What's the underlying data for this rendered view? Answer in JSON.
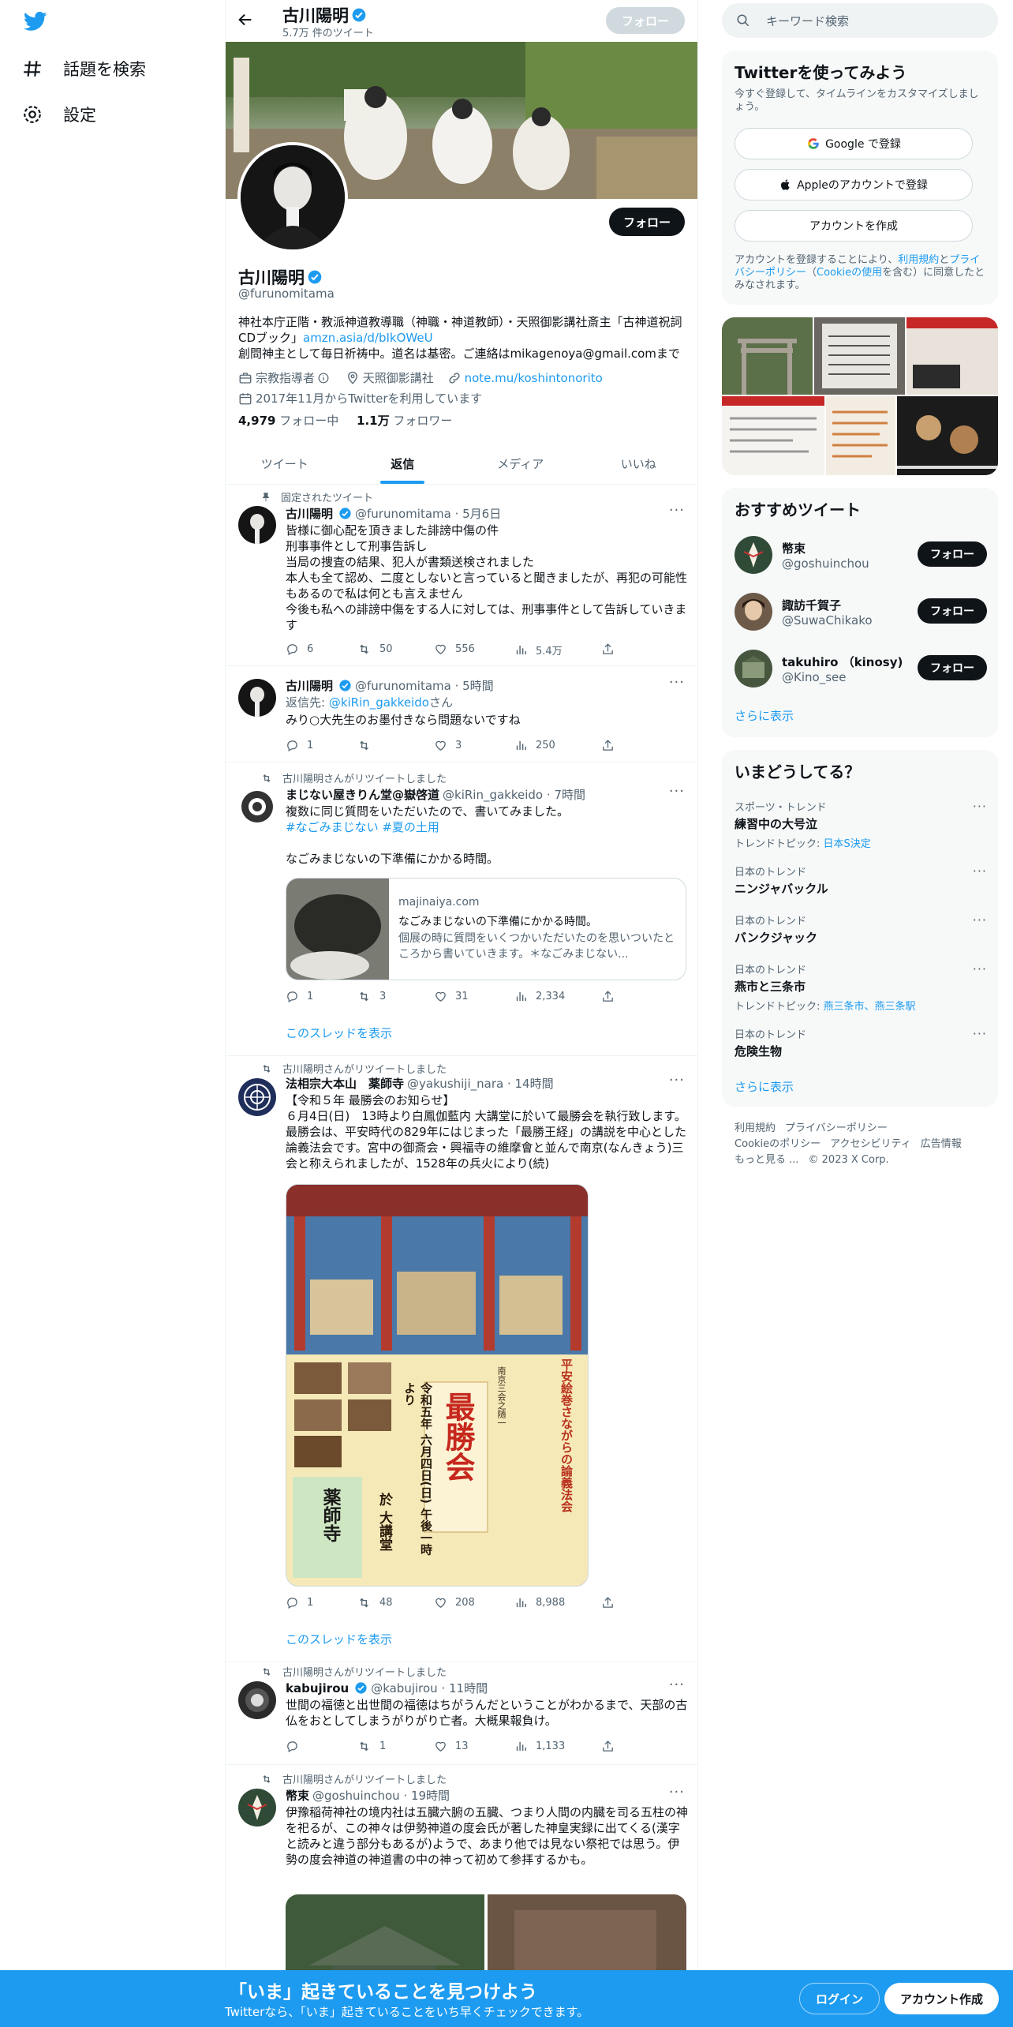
{
  "nav": {
    "explore": "話題を検索",
    "settings": "設定"
  },
  "header": {
    "name": "古川陽明",
    "tweet_count": "5.7万 件のツイート",
    "follow": "フォロー"
  },
  "profile": {
    "name": "古川陽明",
    "handle": "@furunomitama",
    "follow": "フォロー",
    "bio_line1": "神社本庁正階・教派神道教導職（神職・神道教師）・天照御影講社斎主「古神道祝詞CDブック」",
    "bio_link": "amzn.asia/d/bIkOWeU",
    "bio_line2": "創問神主として毎日祈祷中。道名は基密。ご連絡はmikagenoya@gmail.comまで",
    "category": "宗教指導者",
    "location": "天照御影講社",
    "website": "note.mu/koshintonorito",
    "joined": "2017年11月からTwitterを利用しています",
    "following_num": "4,979",
    "following_label": "フォロー中",
    "followers_num": "1.1万",
    "followers_label": "フォロワー"
  },
  "tabs": [
    "ツイート",
    "返信",
    "メディア",
    "いいね"
  ],
  "tweets": [
    {
      "context": "固定されたツイート",
      "name": "古川陽明",
      "handle": "@furunomitama",
      "time": "5月6日",
      "text": "皆様に御心配を頂きました誹謗中傷の件\n刑事事件として刑事告訴し\n当局の捜査の結果、犯人が書類送検されました\n本人も全て認め、二度としないと言っていると聞きましたが、再犯の可能性もあるので私は何とも言えません\n今後も私への誹謗中傷をする人に対しては、刑事事件として告訴していきます",
      "replies": "6",
      "retweets": "50",
      "likes": "556",
      "views": "5.4万"
    },
    {
      "name": "古川陽明",
      "handle": "@furunomitama",
      "time": "5時間",
      "reply_to_label": "返信先: ",
      "reply_to": "@kiRin_gakkeido",
      "reply_to_suffix": "さん",
      "text": "みり○大先生のお墨付きなら問題ないですね",
      "replies": "1",
      "retweets": "",
      "likes": "3",
      "views": "250"
    },
    {
      "context": "古川陽明さんがリツイートしました",
      "name": "まじない屋きりん堂@嶽啓道",
      "handle": "@kiRin_gakkeido",
      "time": "7時間",
      "text1": "複数に同じ質問をいただいたので、書いてみました。",
      "hashtags": "#なごみまじない #夏の土用",
      "text2": "なごみまじないの下準備にかかる時間。",
      "card_domain": "majinaiya.com",
      "card_title": "なごみまじないの下準備にかかる時間。",
      "card_desc": "個展の時に質問をいくつかいただいたのを思いついたところから書いていきます。＊なごみまじない...",
      "replies": "1",
      "retweets": "3",
      "likes": "31",
      "views": "2,334",
      "show_thread": "このスレッドを表示"
    },
    {
      "context": "古川陽明さんがリツイートしました",
      "name": "法相宗大本山　薬師寺",
      "handle": "@yakushiji_nara",
      "time": "14時間",
      "text": "【令和５年 最勝会のお知らせ】\n６月4日(日)　13時より白鳳伽藍内 大講堂に於いて最勝会を執行致します。最勝会は、平安時代の829年にはじまった「最勝王経」の講説を中心とした論義法会です。宮中の御斎会・興福寺の維摩會と並んで南京(なんきょう)三会と称えられましたが、1528年の兵火により(続)",
      "poster_main": "最勝会",
      "poster_side": "平安絵巻さながらの論義法会",
      "poster_date": "令和五年 六月四日(日) 午後一時より",
      "poster_place": "於 大講堂",
      "poster_temple": "薬師寺",
      "poster_kicker": "南京三会之随一",
      "replies": "1",
      "retweets": "48",
      "likes": "208",
      "views": "8,988",
      "show_thread": "このスレッドを表示"
    },
    {
      "context": "古川陽明さんがリツイートしました",
      "name": "kabujirou",
      "handle": "@kabujirou",
      "time": "11時間",
      "text": "世間の福徳と出世間の福徳はちがうんだということがわかるまで、天部の古仏をおとしてしまうがりがり亡者。大概果報負け。",
      "replies": "",
      "retweets": "1",
      "likes": "13",
      "views": "1,133"
    },
    {
      "context": "古川陽明さんがリツイートしました",
      "name": "幣束",
      "handle": "@goshuinchou",
      "time": "19時間",
      "text": "伊豫稲荷神社の境内社は五臓六腑の五臓、つまり人間の内臓を司る五柱の神を祀るが、この神々は伊勢神道の度会氏が著した神皇実録に出てくる(漢字と読みと違う部分もあるが)ようで、あまり他では見ない祭祀では思う。伊勢の度会神道の神道書の中の神って初めて参拝するかも。"
    }
  ],
  "sidebar": {
    "search_placeholder": "キーワード検索",
    "signup_title": "Twitterを使ってみよう",
    "signup_sub": "今すぐ登録して、タイムラインをカスタマイズしましょう。",
    "google": "Google で登録",
    "apple": "Appleのアカウントで登録",
    "create": "アカウントを作成",
    "terms_1": "アカウントを登録することにより、",
    "terms_link1": "利用規約",
    "terms_2": "と",
    "terms_link2": "プライバシーポリシー",
    "terms_3": "（",
    "terms_link3": "Cookieの使用",
    "terms_4": "を含む）に同意したとみなされます。",
    "recommend_title": "おすすめツイート",
    "recommend": [
      {
        "name": "幣束",
        "handle": "@goshuinchou",
        "btn": "フォロー"
      },
      {
        "name": "諏訪千賀子",
        "handle": "@SuwaChikako",
        "btn": "フォロー"
      },
      {
        "name": "takuhiro （kinosy)",
        "handle": "@Kino_see",
        "btn": "フォロー"
      }
    ],
    "show_more": "さらに表示",
    "trends_title": "いまどうしてる？",
    "trends": [
      {
        "cat": "スポーツ・トレンド",
        "name": "練習中の大号泣",
        "sub_label": "トレンドトピック: ",
        "sub_link": "日本S決定"
      },
      {
        "cat": "日本のトレンド",
        "name": "ニンジャバックル"
      },
      {
        "cat": "日本のトレンド",
        "name": "バンクジャック"
      },
      {
        "cat": "日本のトレンド",
        "name": "燕市と三条市",
        "sub_label": "トレンドトピック: ",
        "sub_link": "燕三条市、燕三条駅"
      },
      {
        "cat": "日本のトレンド",
        "name": "危険生物"
      }
    ],
    "footer": [
      "利用規約",
      "プライバシーポリシー",
      "Cookieのポリシー",
      "アクセシビリティ",
      "広告情報",
      "もっと見る ...",
      "© 2023 X Corp."
    ]
  },
  "bottom": {
    "title": "「いま」起きていることを見つけよう",
    "sub": "Twitterなら、「いま」起きていることをいち早くチェックできます。",
    "login": "ログイン",
    "signup": "アカウント作成"
  },
  "colors": {
    "accent": "#1d9bf0",
    "text": "#0f1419",
    "muted": "#536471"
  }
}
